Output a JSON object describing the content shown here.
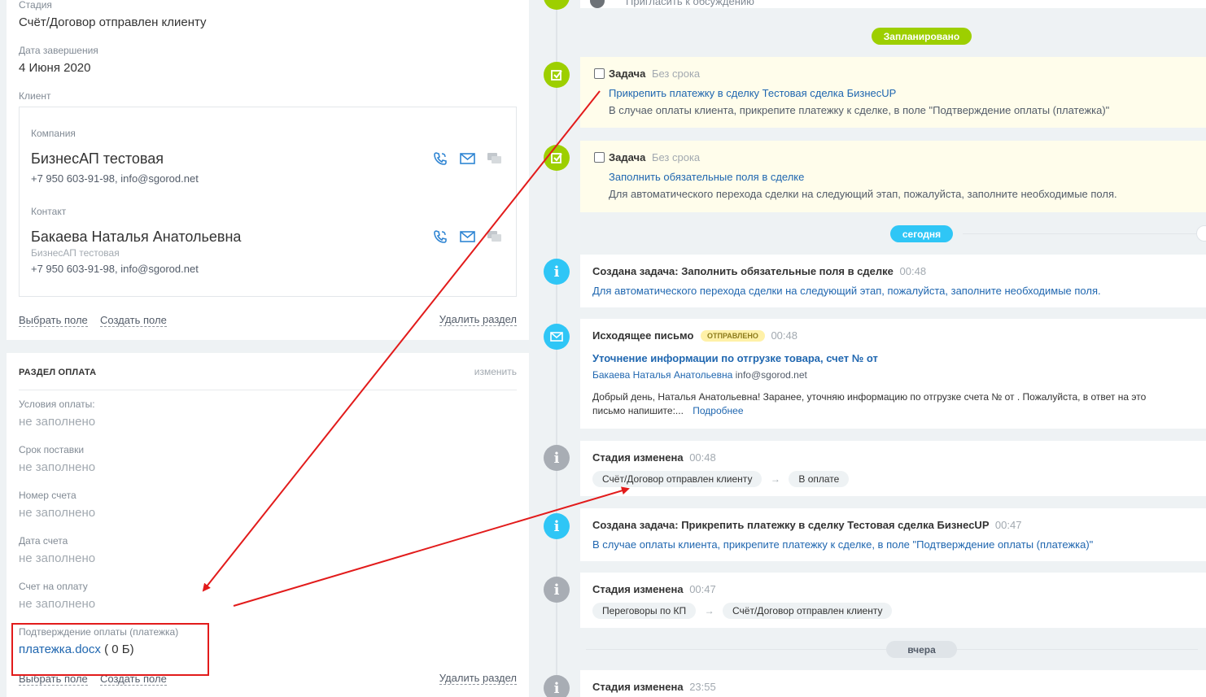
{
  "left": {
    "stage_label": "Стадия",
    "stage_value": "Счёт/Договор отправлен клиенту",
    "end_date_label": "Дата завершения",
    "end_date_value": "4 Июня 2020",
    "client_label": "Клиент",
    "company_label": "Компания",
    "company_name": "БизнесАП тестовая",
    "company_info": "+7 950 603-91-98, info@sgorod.net",
    "contact_label": "Контакт",
    "contact_name": "Бакаева Наталья Анатольевна",
    "contact_company": "БизнесАП тестовая",
    "contact_info": "+7 950 603-91-98, info@sgorod.net",
    "select_field": "Выбрать поле",
    "create_field": "Создать поле",
    "delete_section": "Удалить раздел",
    "payment_section": {
      "title": "РАЗДЕЛ ОПЛАТА",
      "edit": "изменить",
      "fields": [
        {
          "label": "Условия оплаты:",
          "value": "не заполнено"
        },
        {
          "label": "Срок поставки",
          "value": "не заполнено"
        },
        {
          "label": "Номер счета",
          "value": "не заполнено"
        },
        {
          "label": "Дата счета",
          "value": "не заполнено"
        },
        {
          "label": "Счет на оплату",
          "value": "не заполнено"
        }
      ],
      "confirm_label": "Подтверждение оплаты (платежка)",
      "file_name": "платежка.docx",
      "file_size": "( 0 Б)",
      "select_field": "Выбрать поле",
      "create_field": "Создать поле",
      "delete_section": "Удалить раздел"
    }
  },
  "timeline": {
    "invite_text": "Пригласить к обсуждению",
    "planned_label": "Запланировано",
    "today_label": "сегодня",
    "yesterday_label": "вчера",
    "task1": {
      "title": "Задача",
      "deadline": "Без срока",
      "link": "Прикрепить платежку в сделку Тестовая сделка БизнесUP",
      "text": "В случае оплаты клиента, прикрепите платежку к сделке, в поле \"Подтверждение оплаты (платежка)\""
    },
    "task2": {
      "title": "Задача",
      "deadline": "Без срока",
      "link": "Заполнить обязательные поля в сделке",
      "text": "Для автоматического перехода сделки на следующий этап, пожалуйста, заполните необходимые поля."
    },
    "event1": {
      "title": "Создана задача: Заполнить обязательные поля в сделке",
      "time": "00:48",
      "link": "Для автоматического перехода сделки на следующий этап, пожалуйста, заполните необходимые поля."
    },
    "email": {
      "title": "Исходящее письмо",
      "badge": "ОТПРАВЛЕНО",
      "time": "00:48",
      "subject": "Уточнение информации по отгрузке товара, счет № от",
      "recipient": "Бакаева Наталья Анатольевна",
      "recipient_email": "info@sgorod.net",
      "body_line1": "Добрый день, Наталья Анатольевна! Заранее, уточняю информацию по отгрузке счета № от . Пожалуйста,  в ответ на это",
      "body_line2": "письмо напишите:...",
      "more": "Подробнее"
    },
    "stage1": {
      "title": "Стадия изменена",
      "time": "00:48",
      "from": "Счёт/Договор отправлен клиенту",
      "arrow": "→",
      "to": "В оплате"
    },
    "event2": {
      "title": "Создана задача: Прикрепить платежку в сделку Тестовая сделка БизнесUP",
      "time": "00:47",
      "link": "В случае оплаты клиента, прикрепите платежку к сделке, в поле \"Подтверждение оплаты (платежка)\""
    },
    "stage2": {
      "title": "Стадия изменена",
      "time": "00:47",
      "from": "Переговоры по КП",
      "arrow": "→",
      "to": "Счёт/Договор отправлен клиенту"
    },
    "stage3": {
      "title": "Стадия изменена",
      "time": "23:55"
    }
  },
  "colors": {
    "green": "#9dcf00",
    "blue": "#2fc6f6",
    "gray": "#a8adb4",
    "link": "#2067b0",
    "annotation_red": "#e21b1b"
  }
}
